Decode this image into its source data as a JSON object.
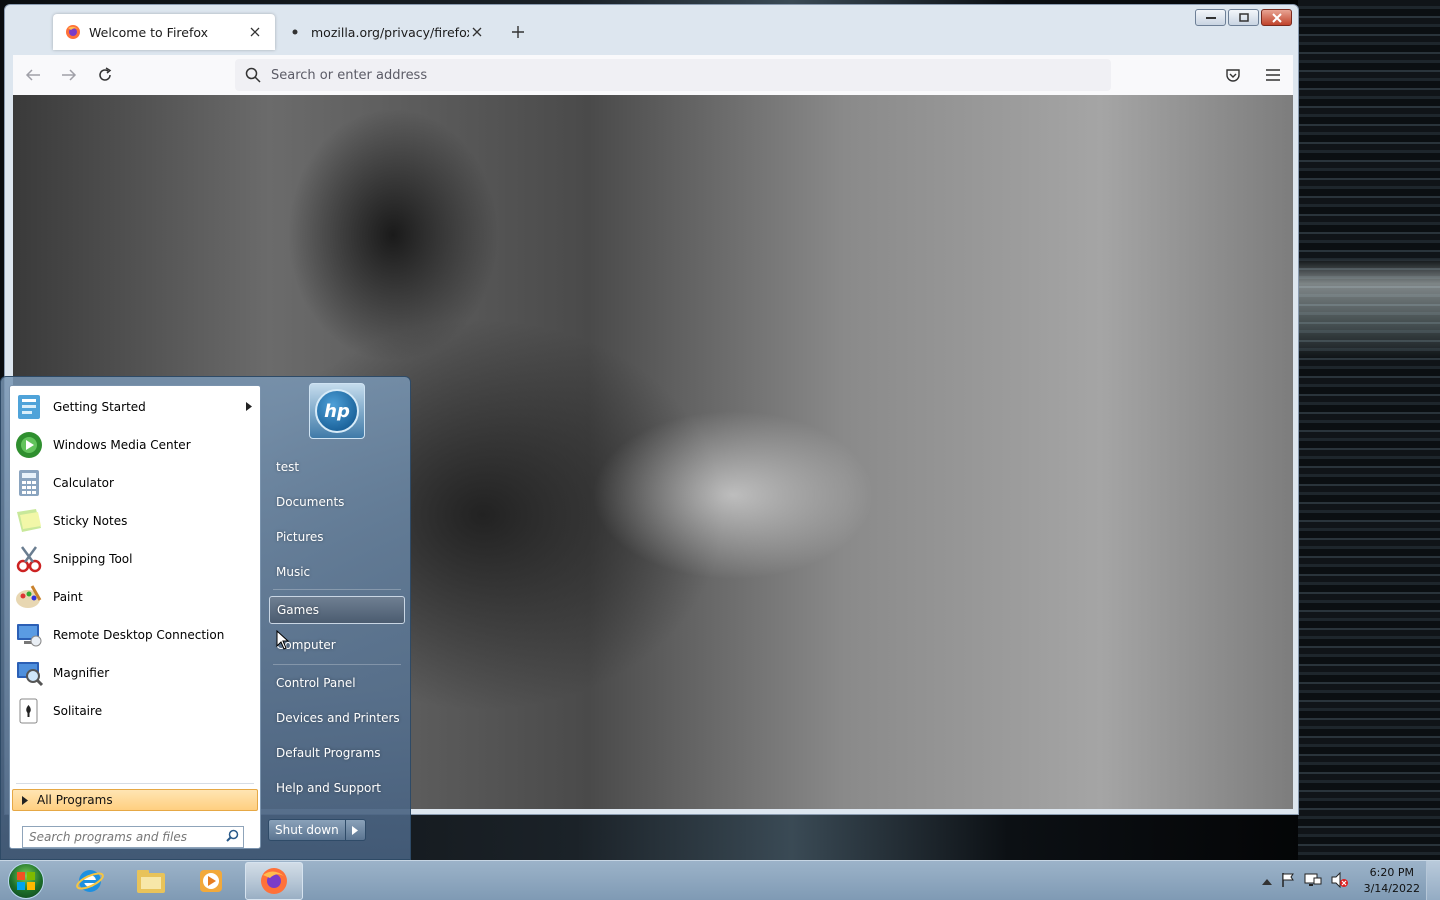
{
  "browser": {
    "tabs": [
      {
        "title": "Welcome to Firefox",
        "active": true
      },
      {
        "title": "mozilla.org/privacy/firefox/",
        "active": false
      }
    ],
    "urlbar": {
      "placeholder": "Search or enter address"
    }
  },
  "startmenu": {
    "pinned": [
      {
        "label": "Getting Started",
        "icon": "getting-started-icon",
        "submenu": true
      },
      {
        "label": "Windows Media Center",
        "icon": "media-center-icon"
      },
      {
        "label": "Calculator",
        "icon": "calculator-icon"
      },
      {
        "label": "Sticky Notes",
        "icon": "sticky-notes-icon"
      },
      {
        "label": "Snipping Tool",
        "icon": "snipping-tool-icon"
      },
      {
        "label": "Paint",
        "icon": "paint-icon"
      },
      {
        "label": "Remote Desktop Connection",
        "icon": "remote-desktop-icon"
      },
      {
        "label": "Magnifier",
        "icon": "magnifier-icon"
      },
      {
        "label": "Solitaire",
        "icon": "solitaire-icon"
      }
    ],
    "all_programs": "All Programs",
    "search_placeholder": "Search programs and files",
    "right_links": [
      "test",
      "Documents",
      "Pictures",
      "Music",
      "Games",
      "Computer",
      "Control Panel",
      "Devices and Printers",
      "Default Programs",
      "Help and Support"
    ],
    "hovered_link": "Games",
    "user_tile": "hp",
    "shutdown": "Shut down"
  },
  "taskbar": {
    "pinned": [
      "start-orb",
      "internet-explorer-icon",
      "explorer-folder-icon",
      "media-player-icon",
      "firefox-icon"
    ],
    "active": "firefox-icon",
    "clock_time": "6:20 PM",
    "clock_date": "3/14/2022"
  },
  "colors": {
    "allprograms_highlight": "#ffcf80",
    "startmenu_glass": "#5d7d9e",
    "taskbar": "#8ea7bf",
    "close_button": "#c0432b"
  }
}
